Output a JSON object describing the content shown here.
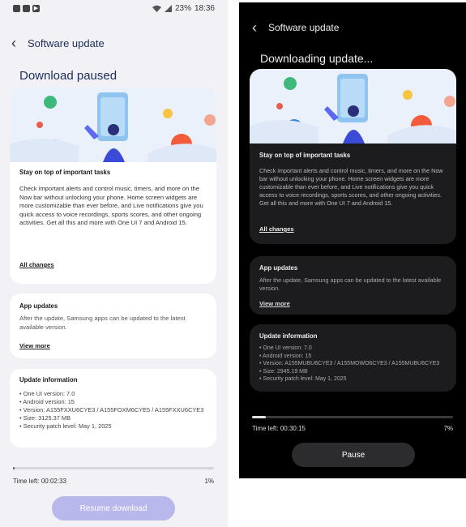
{
  "light": {
    "status": {
      "battery": "23%",
      "time": "18:36"
    },
    "appbar_title": "Software update",
    "headline": "Download paused",
    "main_card": {
      "title": "Stay on top of important tasks",
      "body": "Check important alerts and control music, timers, and more on the Now bar without unlocking your phone. Home screen widgets are more customizable than ever before, and Live notifications give you quick access to voice recordings, sports scores, and other ongoing activities. Get all this and more with One UI 7 and Android 15.",
      "link": "All changes"
    },
    "app_updates": {
      "title": "App updates",
      "body": "After the update, Samsung apps can be updated to the latest available version.",
      "link": "View more"
    },
    "update_info": {
      "title": "Update information",
      "items": [
        "One UI version: 7.0",
        "Android version: 15",
        "Version: A155FXXU6CYE3 / A155FOXM6CYE5 / A155FXXU6CYE3",
        "Size: 3125.37 MB",
        "Security patch level: May 1, 2025"
      ]
    },
    "progress": {
      "percent_value": 1,
      "time_left": "Time left: 00:02:33",
      "percent_label": "1%"
    },
    "button": "Resume download"
  },
  "dark": {
    "appbar_title": "Software update",
    "headline": "Downloading update...",
    "main_card": {
      "title": "Stay on top of important tasks",
      "body": "Check important alerts and control music, timers, and more on the Now bar without unlocking your phone. Home screen widgets are more customizable than ever before, and Live notifications give you quick access to voice recordings, sports scores, and other ongoing activities. Get all this and more with One UI 7 and Android 15.",
      "link": "All changes"
    },
    "app_updates": {
      "title": "App updates",
      "body": "After the update, Samsung apps can be updated to the latest available version.",
      "link": "View more"
    },
    "update_info": {
      "title": "Update information",
      "items": [
        "One UI version: 7.0",
        "Android version: 15",
        "Version: A155MUBU6CYE3 / A155MOWO6CYE3 / A155MUBU6CYE3",
        "Size: 2945.19 MB",
        "Security patch level: May 1, 2025"
      ]
    },
    "progress": {
      "percent_value": 7,
      "time_left": "Time left: 00:30:15",
      "percent_label": "7%"
    },
    "button": "Pause"
  },
  "colors": {
    "light_progress_fill": "#5a5a66",
    "light_button_bg": "#b9b8ec",
    "dark_progress_fill": "#e0e0e0",
    "dark_button_bg": "#2c2c2e",
    "banner_bg": "#e8f0fa"
  }
}
